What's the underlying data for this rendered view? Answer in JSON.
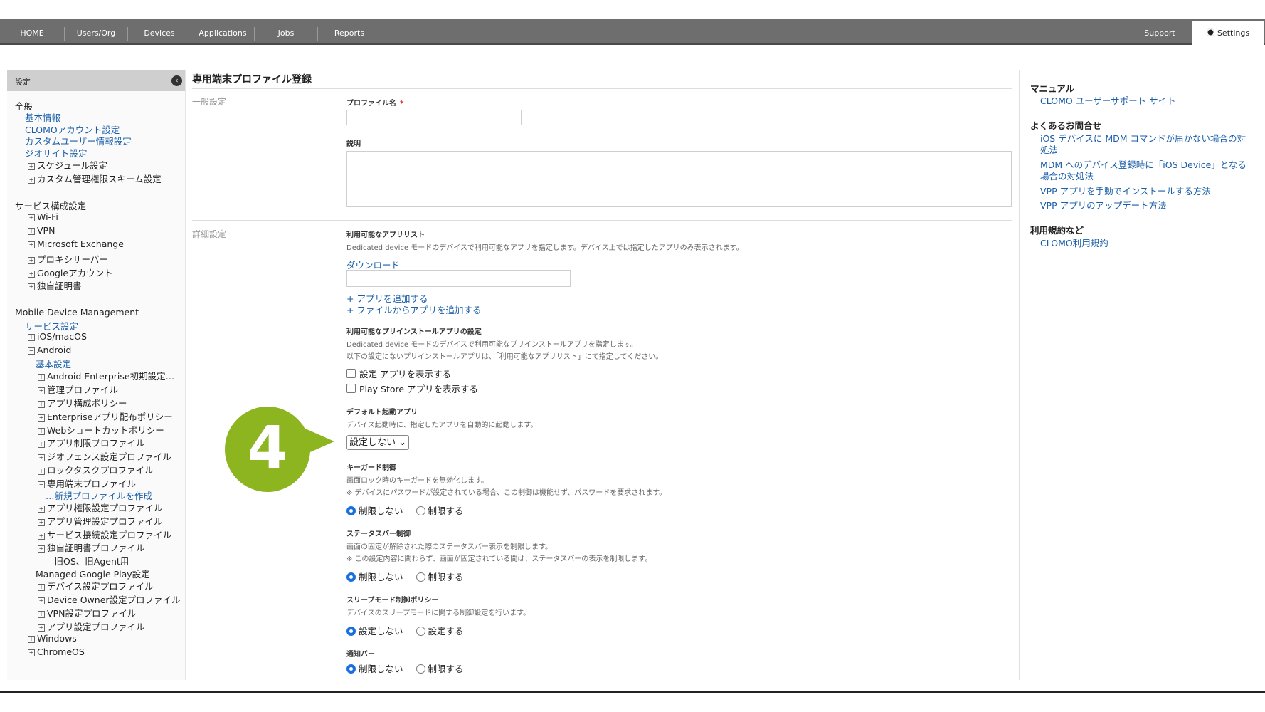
{
  "nav": {
    "items": [
      "HOME",
      "Users/Org",
      "Devices",
      "Applications",
      "Jobs",
      "Reports"
    ],
    "support": "Support",
    "settings": "Settings"
  },
  "sidebar": {
    "header": "設定",
    "general": {
      "title": "全般",
      "links": [
        "基本情報",
        "CLOMOアカウント設定",
        "カスタムユーザー情報設定",
        "ジオサイト設定"
      ],
      "expandables": [
        "スケジュール設定",
        "カスタム管理権限スキーム設定"
      ]
    },
    "service": {
      "title": "サービス構成設定",
      "items": [
        "Wi-Fi",
        "VPN",
        "Microsoft Exchange",
        "プロキシサーバー",
        "Googleアカウント",
        "独自証明書"
      ]
    },
    "mdm": {
      "title": "Mobile Device Management",
      "service_settings": "サービス設定",
      "ios": "iOS/macOS",
      "android": "Android",
      "basic": "基本設定",
      "android_items_a": [
        "Android Enterprise初期設定…",
        "管理プロファイル",
        "アプリ構成ポリシー",
        "Enterpriseアプリ配布ポリシー",
        "Webショートカットポリシー",
        "アプリ制限プロファイル",
        "ジオフェンス設定プロファイル",
        "ロックタスクプロファイル"
      ],
      "dedicated": "専用端末プロファイル",
      "new_profile": "…新規プロファイルを作成",
      "android_items_b": [
        "アプリ権限設定プロファイル",
        "アプリ管理設定プロファイル",
        "サービス接続設定プロファイル",
        "独自証明書プロファイル"
      ],
      "legacy_divider": "----- 旧OS、旧Agent用 -----",
      "managed_play": "Managed Google Play設定",
      "android_items_c": [
        "デバイス設定プロファイル",
        "Device Owner設定プロファイル",
        "VPN設定プロファイル",
        "アプリ設定プロファイル"
      ],
      "windows": "Windows",
      "chromeos": "ChromeOS"
    }
  },
  "main": {
    "title": "専用端末プロファイル登録",
    "general_section": "一般設定",
    "profile_name_label": "プロファイル名",
    "required_mark": "*",
    "description_label": "説明",
    "detail_section": "詳細設定",
    "app_list_label": "利用可能なアプリリスト",
    "app_list_desc": "Dedicated device モードのデバイスで利用可能なアプリを指定します。デバイス上では指定したアプリのみ表示されます。",
    "download": "ダウンロード",
    "add_app": "+ アプリを追加する",
    "add_from_file": "+ ファイルからアプリを追加する",
    "preinstall_label": "利用可能なプリインストールアプリの設定",
    "preinstall_desc1": "Dedicated device モードのデバイスで利用可能なプリインストールアプリを指定します。",
    "preinstall_desc2": "以下の設定にないプリインストールアプリは、「利用可能なアプリリスト」にて指定してください。",
    "show_settings_app": "設定 アプリを表示する",
    "show_play_store": "Play Store アプリを表示する",
    "default_app_label": "デフォルト起動アプリ",
    "default_app_desc": "デバイス起動時に、指定したアプリを自動的に起動します。",
    "default_app_value": "設定しない",
    "keyguard_label": "キーガード制御",
    "keyguard_desc1": "画面ロック時のキーガードを無効化します。",
    "keyguard_desc2": "※ デバイスにパスワードが設定されている場合、この制御は機能せず、パスワードを要求されます。",
    "no_restrict": "制限しない",
    "restrict": "制限する",
    "statusbar_label": "ステータスバー制御",
    "statusbar_desc1": "画面の固定が解除された際のステータスバー表示を制限します。",
    "statusbar_desc2": "※ この設定内容に関わらず、画面が固定されている間は、ステータスバーの表示を制限します。",
    "sleep_label": "スリープモード制御ポリシー",
    "sleep_desc": "デバイスのスリープモードに関する制御設定を行います。",
    "not_set": "設定しない",
    "set": "設定する",
    "notify_label": "通知バー",
    "callout_number": "4"
  },
  "rightbar": {
    "manual_title": "マニュアル",
    "manual_link": "CLOMO ユーザーサポート サイト",
    "faq_title": "よくあるお問合せ",
    "faq_links": [
      "iOS デバイスに MDM コマンドが届かない場合の対処法",
      "MDM へのデバイス登録時に「iOS Device」となる場合の対処法",
      "VPP アプリを手動でインストールする方法",
      "VPP アプリのアップデート方法"
    ],
    "terms_title": "利用規約など",
    "terms_link": "CLOMO利用規約"
  },
  "colors": {
    "nav_bg": "#6e6e6e",
    "link": "#1a5ea8",
    "callout": "#8cb520",
    "radio_on": "#1a6fe0"
  }
}
